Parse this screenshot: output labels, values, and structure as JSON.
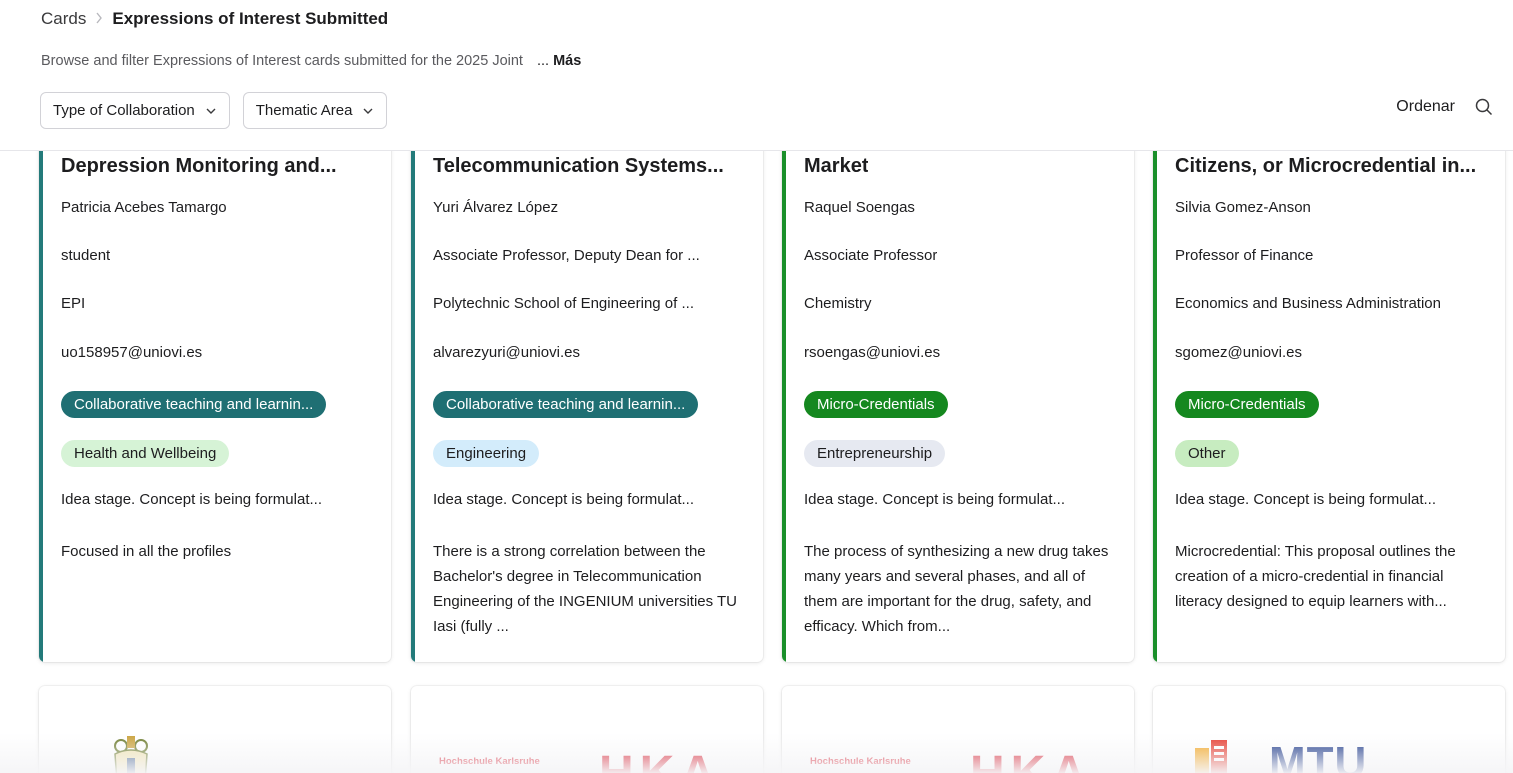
{
  "breadcrumb": {
    "parent": "Cards",
    "separator": ">",
    "current": "Expressions of Interest Submitted"
  },
  "description": {
    "text": "Browse and filter Expressions of Interest cards submitted for the 2025 Joint",
    "more_dots": "...",
    "more_label": "Más"
  },
  "filters": [
    {
      "label": "Type of Collaboration",
      "icon": "chevron-down-icon"
    },
    {
      "label": "Thematic Area",
      "icon": "chevron-down-icon"
    }
  ],
  "toolbar": {
    "sort_label": "Ordenar",
    "search_icon": "search-icon"
  },
  "colors": {
    "teal_accent": "#237a7a",
    "green_accent": "#1a8f2a",
    "pill_teal_bg": "#1f6f73",
    "pill_green_bg": "#15881f",
    "pill_health_bg": "#d6f3d6",
    "pill_engineering_bg": "#d3ecfb",
    "pill_entrepreneurship_bg": "#e6e9f1",
    "pill_other_bg": "#c7ecc0"
  },
  "cards": [
    {
      "title": "Depression Monitoring and...",
      "name": "Patricia Acebes Tamargo",
      "role": "student",
      "department": "EPI",
      "email": "uo158957@uniovi.es",
      "collaboration": "Collaborative teaching and learnin...",
      "thematic": "Health and Wellbeing",
      "stage": "Idea stage. Concept is being formulat...",
      "description": "Focused in all the profiles"
    },
    {
      "title": "Telecommunication Systems...",
      "name": "Yuri Álvarez López",
      "role": "Associate Professor, Deputy Dean for ...",
      "department": "Polytechnic School of Engineering of ...",
      "email": "alvarezyuri@uniovi.es",
      "collaboration": "Collaborative teaching and learnin...",
      "thematic": "Engineering",
      "stage": "Idea stage. Concept is being formulat...",
      "description": "There is a strong correlation between the Bachelor's degree in Telecommunication Engineering of the INGENIUM universities TU Iasi (fully ..."
    },
    {
      "title": "Market",
      "name": "Raquel Soengas",
      "role": "Associate Professor",
      "department": "Chemistry",
      "email": "rsoengas@uniovi.es",
      "collaboration": "Micro-Credentials",
      "thematic": "Entrepreneurship",
      "stage": "Idea stage. Concept is being formulat...",
      "description": "The process of synthesizing a new drug takes many years and several phases, and all of them are important for the drug, safety, and efficacy. Which from..."
    },
    {
      "title": "Citizens, or Microcredential in...",
      "name": "Silvia Gomez-Anson",
      "role": "Professor of Finance",
      "department": "Economics and Business Administration",
      "email": "sgomez@uniovi.es",
      "collaboration": "Micro-Credentials",
      "thematic": "Other",
      "stage": "Idea stage. Concept is being formulat...",
      "description": "Microcredential: This proposal outlines the creation of a micro-credential in financial literacy designed to equip learners with..."
    }
  ],
  "logos": [
    {
      "type": "university-seal-logo"
    },
    {
      "type": "hka-logo",
      "small_text": "Hochschule Karlsruhe",
      "big_text": "HKA"
    },
    {
      "type": "hka-logo",
      "small_text": "Hochschule Karlsruhe",
      "big_text": "HKA"
    },
    {
      "type": "mtu-logo",
      "text": "MTU"
    }
  ]
}
